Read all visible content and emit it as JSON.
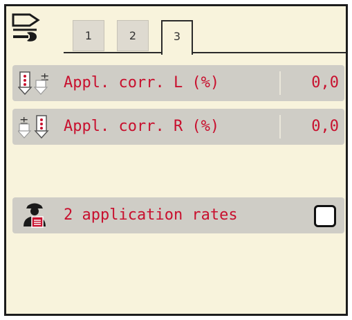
{
  "tabs": [
    {
      "label": "1",
      "active": false
    },
    {
      "label": "2",
      "active": false
    },
    {
      "label": "3",
      "active": true
    }
  ],
  "rows": [
    {
      "label": "Appl. corr. L (%)",
      "value": "0,0",
      "icon": "application-correction-left-icon"
    },
    {
      "label": "Appl. corr. R (%)",
      "value": "0,0",
      "icon": "application-correction-right-icon"
    }
  ],
  "option": {
    "label": "2 application rates",
    "checked": false,
    "icon": "operator-document-icon"
  },
  "colors": {
    "accent_text": "#c8102e",
    "background": "#f8f3dc",
    "row_background": "#cfcdc6"
  }
}
